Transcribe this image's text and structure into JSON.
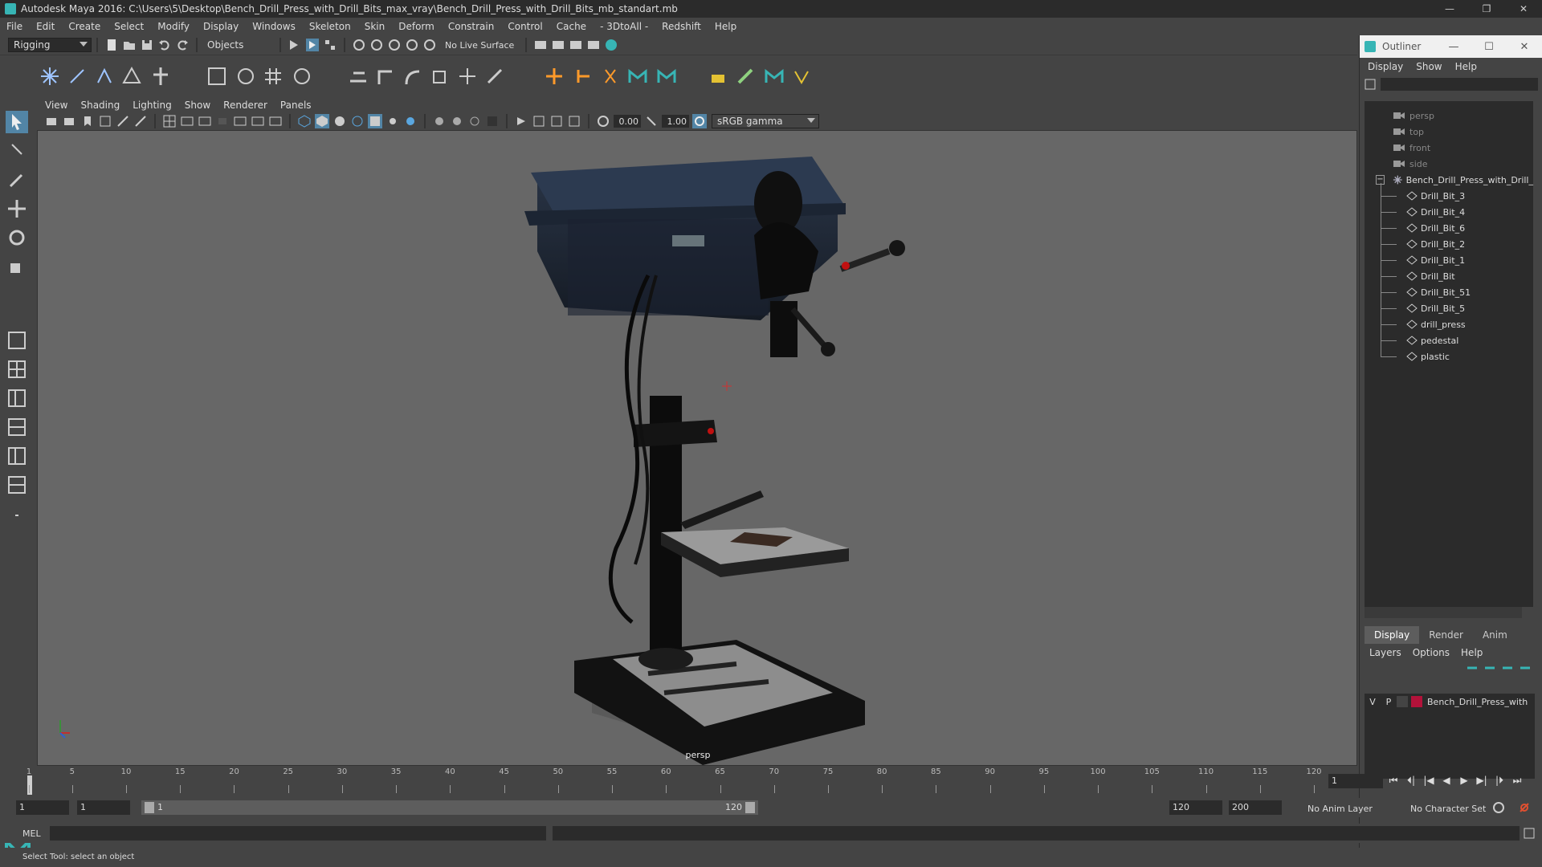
{
  "window": {
    "title": "Autodesk Maya 2016: C:\\Users\\5\\Desktop\\Bench_Drill_Press_with_Drill_Bits_max_vray\\Bench_Drill_Press_with_Drill_Bits_mb_standart.mb",
    "minimize": "—",
    "restore": "❐",
    "close": "✕"
  },
  "menubar": [
    "File",
    "Edit",
    "Create",
    "Select",
    "Modify",
    "Display",
    "Windows",
    "Skeleton",
    "Skin",
    "Deform",
    "Constrain",
    "Control",
    "Cache",
    "- 3DtoAll -",
    "Redshift",
    "Help"
  ],
  "statusline": {
    "menuset": "Rigging",
    "selection_mode": "Objects",
    "live_surface": "No Live Surface"
  },
  "viewport": {
    "menus": [
      "View",
      "Shading",
      "Lighting",
      "Show",
      "Renderer",
      "Panels"
    ],
    "exposure": "0.00",
    "gamma": "1.00",
    "color_space": "sRGB gamma",
    "camera": "persp"
  },
  "outliner": {
    "title": "Outliner",
    "menus": [
      "Display",
      "Show",
      "Help"
    ],
    "cameras": [
      "persp",
      "top",
      "front",
      "side"
    ],
    "root": "Bench_Drill_Press_with_Drill_",
    "children": [
      "Drill_Bit_3",
      "Drill_Bit_4",
      "Drill_Bit_6",
      "Drill_Bit_2",
      "Drill_Bit_1",
      "Drill_Bit",
      "Drill_Bit_51",
      "Drill_Bit_5",
      "drill_press",
      "pedestal",
      "plastic"
    ],
    "collapse_glyph": "−"
  },
  "layers": {
    "tabs": [
      "Display",
      "Render",
      "Anim"
    ],
    "menus": [
      "Layers",
      "Options",
      "Help"
    ],
    "row": {
      "v": "V",
      "p": "P",
      "name": "Bench_Drill_Press_with",
      "color": "#b3123a"
    }
  },
  "timeline": {
    "ticks": [
      "1",
      "5",
      "10",
      "15",
      "20",
      "25",
      "30",
      "35",
      "40",
      "45",
      "50",
      "55",
      "60",
      "65",
      "70",
      "75",
      "80",
      "85",
      "90",
      "95",
      "100",
      "105",
      "110",
      "115",
      "120"
    ],
    "current_frame": "1",
    "playback_icons": [
      "⏮",
      "⏴|",
      "|◀",
      "◀",
      "▶",
      "▶|",
      "|⏵",
      "⏭"
    ]
  },
  "range": {
    "start_field": "1",
    "anim_start": "1",
    "slider_start": "1",
    "slider_end": "120",
    "anim_end": "120",
    "end_field": "200",
    "anim_layer": "No Anim Layer",
    "character_set": "No Character Set"
  },
  "cmdline": {
    "label": "MEL"
  },
  "helpline": {
    "text": "Select Tool: select an object"
  },
  "colors": {
    "accent": "#37b5b5",
    "panel": "#444444",
    "field": "#2b2b2b",
    "viewport_bg": "#676767"
  }
}
